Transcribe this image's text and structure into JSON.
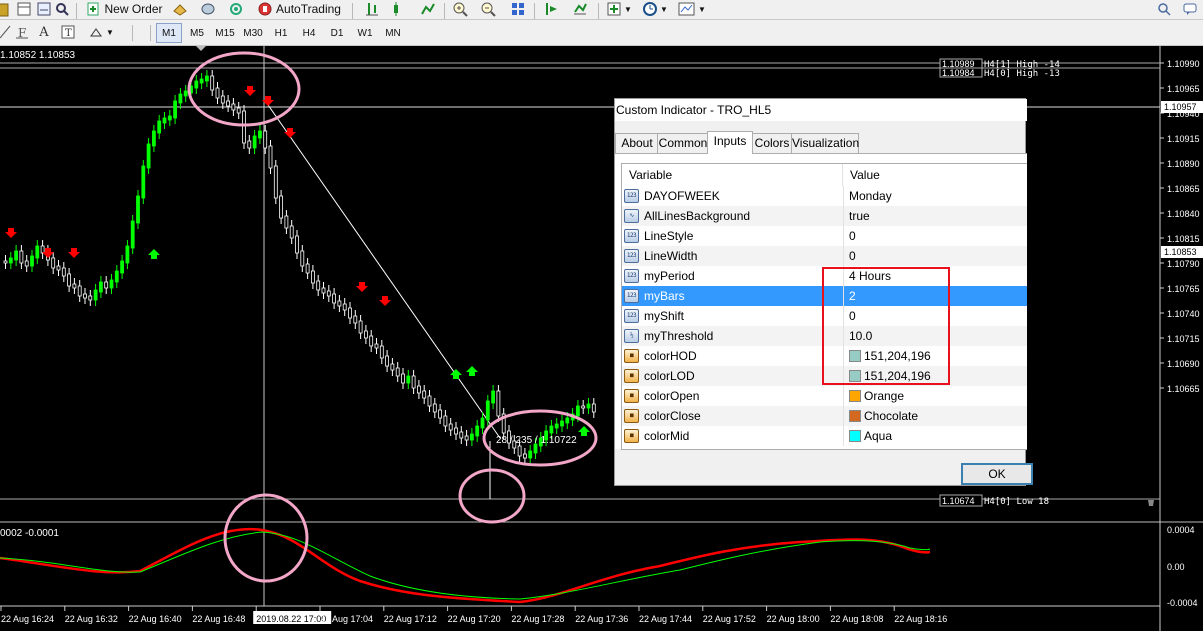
{
  "toolbar": {
    "new_order_label": "New Order",
    "auto_trading_label": "AutoTrading",
    "timeframes": [
      "M1",
      "M5",
      "M15",
      "M30",
      "H1",
      "H4",
      "D1",
      "W1",
      "MN"
    ],
    "active_timeframe": "M1"
  },
  "chart": {
    "bid_ask_label": "1.10852 1.10853",
    "price_axis": [
      "1.10990",
      "1.10965",
      "1.10940",
      "1.10915",
      "1.10890",
      "1.10865",
      "1.10840",
      "1.10815",
      "1.10790",
      "1.10765",
      "1.10740",
      "1.10715",
      "1.10690",
      "1.10665"
    ],
    "current_price_label": "1.10957",
    "level_price_label": "1.10853",
    "high_levels": [
      {
        "price": "1.10989",
        "text": "H4[1] High  -14"
      },
      {
        "price": "1.10984",
        "text": "H4[0] High  -13"
      }
    ],
    "low_level": {
      "price": "1.10674",
      "text": "H4[0] Low  18"
    },
    "crosshair_info": "28 / 235 / 1.10722",
    "indicator_label": "0002 -0.0001",
    "indicator_axis": [
      "0.0004",
      "0.00",
      "-0.0004"
    ],
    "time_axis": [
      "22 Aug 16:24",
      "22 Aug 16:32",
      "22 Aug 16:40",
      "22 Aug 16:48",
      "2019.08.22 17:00",
      "22 Aug 17:04",
      "22 Aug 17:12",
      "22 Aug 17:20",
      "22 Aug 17:28",
      "22 Aug 17:36",
      "22 Aug 17:44",
      "22 Aug 17:52",
      "22 Aug 18:00",
      "22 Aug 18:08",
      "22 Aug 18:16"
    ],
    "colors": {
      "bull": "#00ff00",
      "bear": "#ffffff",
      "buy_arrow": "#00ff00",
      "sell_arrow": "#ff0000",
      "oscillator_fast": "#ff0000",
      "oscillator_slow": "#00ff00",
      "annotation_circle": "#f2a6c8",
      "trend_line": "#ffffff"
    }
  },
  "dialog": {
    "title": "Custom Indicator - TRO_HL5",
    "tabs": [
      "About",
      "Common",
      "Inputs",
      "Colors",
      "Visualization"
    ],
    "active_tab": "Inputs",
    "columns": {
      "variable": "Variable",
      "value": "Value"
    },
    "rows": [
      {
        "icon": "int-icon",
        "name": "DAYOFWEEK",
        "value": "Monday"
      },
      {
        "icon": "chart-icon",
        "name": "AllLinesBackground",
        "value": "true"
      },
      {
        "icon": "int-icon",
        "name": "LineStyle",
        "value": "0"
      },
      {
        "icon": "int-icon",
        "name": "LineWidth",
        "value": "0"
      },
      {
        "icon": "int-icon",
        "name": "myPeriod",
        "value": "4 Hours"
      },
      {
        "icon": "int-icon",
        "name": "myBars",
        "value": "2"
      },
      {
        "icon": "int-icon",
        "name": "myShift",
        "value": "0"
      },
      {
        "icon": "double-icon",
        "name": "myThreshold",
        "value": "10.0"
      },
      {
        "icon": "color-icon",
        "name": "colorHOD",
        "value": "151,204,196",
        "swatch": "#97ccc4"
      },
      {
        "icon": "color-icon",
        "name": "colorLOD",
        "value": "151,204,196",
        "swatch": "#97ccc4"
      },
      {
        "icon": "color-icon",
        "name": "colorOpen",
        "value": "Orange",
        "swatch": "#ffa500"
      },
      {
        "icon": "color-icon",
        "name": "colorClose",
        "value": "Chocolate",
        "swatch": "#d2691e"
      },
      {
        "icon": "color-icon",
        "name": "colorMid",
        "value": "Aqua",
        "swatch": "#00ffff"
      }
    ],
    "selected_row": "myBars",
    "ok_label": "OK"
  }
}
